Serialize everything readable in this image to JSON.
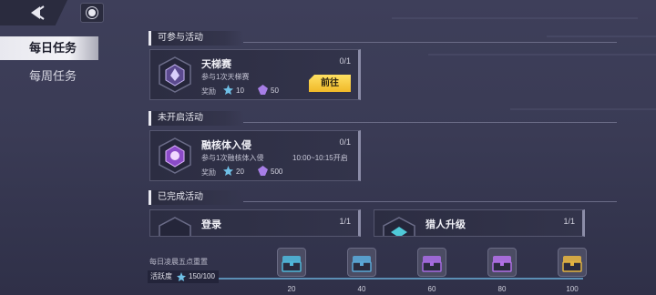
{
  "sidebar": {
    "tabs": [
      {
        "label": "每日任务",
        "active": true
      },
      {
        "label": "每周任务",
        "active": false
      }
    ]
  },
  "sections": {
    "available": {
      "title": "可参与活动"
    },
    "not_open": {
      "title": "未开启活动"
    },
    "completed": {
      "title": "已完成活动"
    }
  },
  "cards": {
    "ladder": {
      "title": "天梯赛",
      "progress": "0/1",
      "desc": "参与1次天梯赛",
      "reward_label": "奖励",
      "reward1": "10",
      "reward2": "50",
      "button": "前往"
    },
    "fusion": {
      "title": "融核体入侵",
      "progress": "0/1",
      "desc": "参与1次融核体入侵",
      "time": "10:00~10:15开启",
      "reward_label": "奖励",
      "reward1": "20",
      "reward2": "500"
    },
    "login": {
      "title": "登录",
      "progress": "1/1"
    },
    "hunter": {
      "title": "猎人升级",
      "progress": "1/1"
    }
  },
  "activity": {
    "reset_note": "每日凌晨五点重置",
    "label": "活跃度",
    "value": "150/100",
    "milestones": [
      "20",
      "40",
      "60",
      "80",
      "100"
    ],
    "chest_colors": [
      "#4fb6d8",
      "#5aa7d6",
      "#a56be0",
      "#b070e6",
      "#e2b341"
    ]
  },
  "colors": {
    "accent_yellow": "#f0b928",
    "track_blue": "#5b8fb5"
  }
}
